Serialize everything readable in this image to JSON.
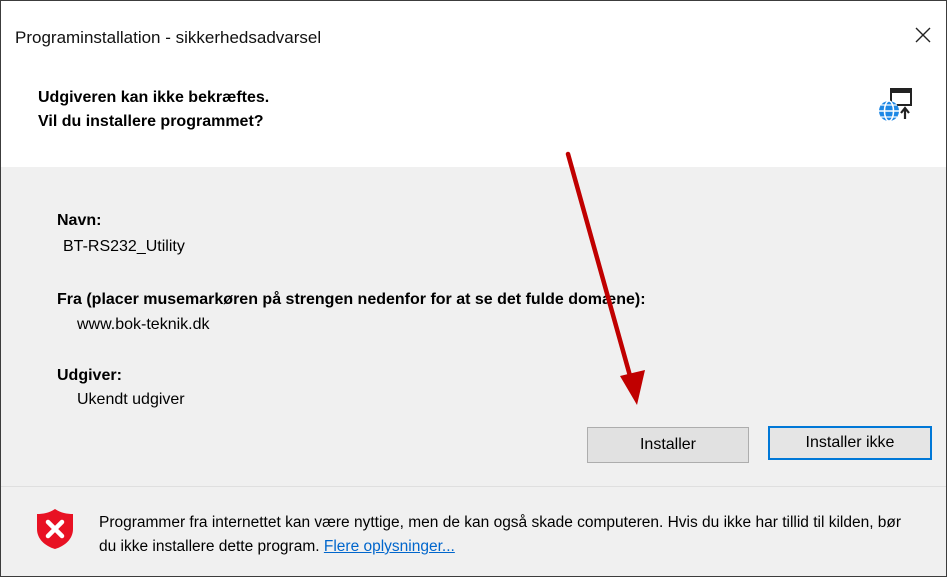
{
  "window": {
    "title": "Programinstallation - sikkerhedsadvarsel",
    "close_symbol": "✕"
  },
  "header": {
    "headline": "Udgiveren kan ikke bekræftes.",
    "question": "Vil du installere programmet?",
    "icon": "globe-install-icon"
  },
  "details": {
    "name_label": "Navn:",
    "name_value": "BT-RS232_Utility",
    "from_label": "Fra (placer musemarkøren på strengen nedenfor for at se det fulde domæne):",
    "from_value": "www.bok-teknik.dk",
    "publisher_label": "Udgiver:",
    "publisher_value": "Ukendt udgiver"
  },
  "buttons": {
    "install": "Installer",
    "dont_install": "Installer ikke"
  },
  "warning": {
    "icon": "shield-x-icon",
    "text": "Programmer fra internettet kan være nyttige, men de kan også skade computeren. Hvis du ikke har tillid til kilden, bør du ikke installere dette program.",
    "link": "Flere oplysninger..."
  },
  "colors": {
    "accent": "#0078d7",
    "arrow": "#c00000",
    "warning_red": "#e81123",
    "link": "#0066cc"
  }
}
